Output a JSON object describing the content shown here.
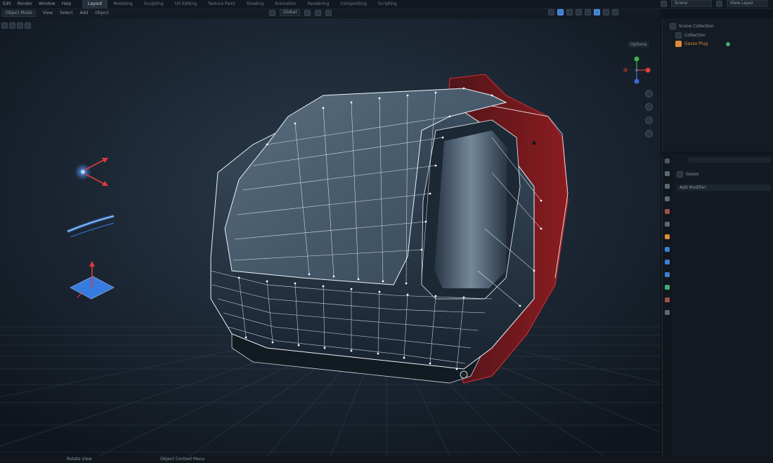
{
  "menubar": {
    "items": [
      "Edit",
      "Render",
      "Window",
      "Help"
    ],
    "workspaces": [
      "Layout",
      "Modeling",
      "Sculpting",
      "UV Editing",
      "Texture Paint",
      "Shading",
      "Animation",
      "Rendering",
      "Compositing",
      "Scripting"
    ],
    "active_workspace": "Layout",
    "scene_label": "Scene",
    "view_layer_label": "View Layer"
  },
  "viewport_header": {
    "mode": "Object Mode",
    "menus": [
      "View",
      "Select",
      "Add",
      "Object"
    ],
    "transform_orientation": "Global",
    "options_label": "Options"
  },
  "outliner": {
    "title": "Scene Collection",
    "collection": "Collection",
    "object": "Gesso Plug"
  },
  "properties": {
    "object_name": "Gesso",
    "modifier_label": "Add Modifier"
  },
  "statusbar": {
    "left": "Rotate View",
    "middle": "Object Context Menu"
  },
  "colors": {
    "accent_blue": "#3d8bff",
    "selection_red": "#c0262a",
    "wire": "#e8f0f8",
    "orange": "#e08a3c"
  },
  "icons": [
    "vertex-normal-icon",
    "curve-icon",
    "plane-normal-icon",
    "nav-gizmo-icon"
  ]
}
